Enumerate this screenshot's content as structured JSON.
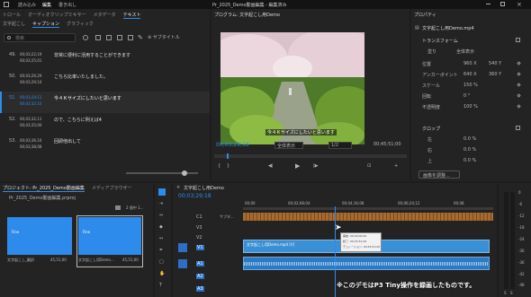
{
  "menubar": {
    "items": [
      "読み込み",
      "編集",
      "書き出し"
    ],
    "title": "Pr_2025_Demo動画編集 - 編集済み"
  },
  "left_panel": {
    "tabs": [
      "トロール",
      "オーディオクリップミキサー",
      "メタデータ",
      "テキスト"
    ],
    "subtabs": [
      "文字起こし",
      "キャプション",
      "グラフィック"
    ],
    "search_placeholder": "検索",
    "caption_button": "サブタイトル",
    "transcript": [
      {
        "num": "49.",
        "start": "00;03;22;19",
        "end": "00;03;25;01",
        "text": "非常に便利に活用することができます"
      },
      {
        "num": "50.",
        "start": "00;03;26;29",
        "end": "00;03;29;10",
        "text": "こちら比率いたしました。"
      },
      {
        "num": "51.",
        "start": "00;03;29;11",
        "end": "00;03;32;10",
        "text": "今４Ｋサイズにしたいと思います"
      },
      {
        "num": "52.",
        "start": "00;03;32;11",
        "end": "00;03;35;00",
        "text": "ので、こちらに例えば4"
      },
      {
        "num": "53.",
        "start": "00;03;36;16",
        "end": "00;03;38;08",
        "text": "回即他出して"
      }
    ]
  },
  "program_monitor": {
    "title": "プログラム: 文字起こし用Demo",
    "subtitle_overlay": "今４Ｋサイズにしたいと思います",
    "timecode": "00;03;29;18",
    "fit": "全体表示",
    "scale": "1/2",
    "duration": "00;45;51;00"
  },
  "properties": {
    "header": "プロパティ",
    "clip": "文字起こし用Demo.mp4",
    "transform_label": "トランスフォーム",
    "ellipse_label": "塗り",
    "fill_label": "全体表示",
    "rows": [
      {
        "label": "位置",
        "v1": "960 X",
        "v2": "540 Y"
      },
      {
        "label": "アンカーポイント",
        "v1": "640 X",
        "v2": "360 Y"
      },
      {
        "label": "スケール",
        "v1": "150 %",
        "v2": ""
      },
      {
        "label": "回転",
        "v1": "0 °",
        "v2": ""
      },
      {
        "label": "不透明度",
        "v1": "100 %",
        "v2": ""
      }
    ],
    "crop_label": "クロップ",
    "crop_rows": [
      {
        "label": "左",
        "v": "0.0 %"
      },
      {
        "label": "右",
        "v": "0.0 %"
      },
      {
        "label": "上",
        "v": "0.0 %"
      }
    ],
    "button": "画像を調整..."
  },
  "project_panel": {
    "tabs": [
      "プロジェクト: Pr_2025_Demo動画編集",
      "メディアブラウザー"
    ],
    "path": "Pr_2025_Demo動画編集.prproj",
    "count": "2 個中 1...",
    "items": [
      {
        "name": "文字起こし_翻訳",
        "duration": "45,51,00",
        "thumb": "Fine"
      },
      {
        "name": "文字起こし用Demo...",
        "duration": "45,51,00",
        "thumb": "Fine"
      }
    ]
  },
  "timeline": {
    "tab": "文字起こし用Demo",
    "timecode": "00;03;29;18",
    "ruler": [
      "00;00",
      "00;02;08;04",
      "00;04;16;08",
      "00;06;24;12",
      "00;08"
    ],
    "caption_track": "サブタ...",
    "clip_label": "文字起こし用Demo.mp4 [V]",
    "tooltip": [
      "開始: 00;00;00;00",
      "終了: 00;45;51;00",
      "デュレーション: 00;45;51;00"
    ],
    "tracks": [
      "C1",
      "V3",
      "V2",
      "V1",
      "A1",
      "A2",
      "A3"
    ]
  },
  "audio_meter": {
    "scale": [
      "0",
      "-6",
      "-12",
      "-18",
      "-24",
      "-30",
      "-36",
      "-42",
      "-48"
    ],
    "labels": [
      "S",
      "S"
    ]
  },
  "watermark": "※このデモはP3 Tiny操作を録画したものです。"
}
